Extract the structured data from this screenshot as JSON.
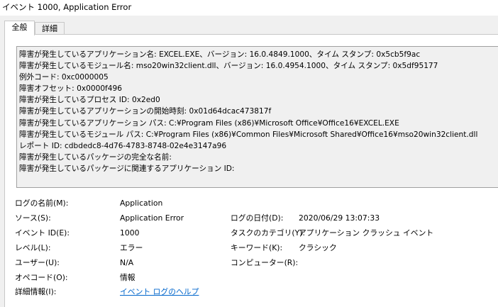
{
  "window": {
    "title": "イベント 1000, Application Error"
  },
  "tabs": [
    {
      "label": "全般",
      "active": true
    },
    {
      "label": "詳細",
      "active": false
    }
  ],
  "description": {
    "lines": [
      "障害が発生しているアプリケーション名: EXCEL.EXE、バージョン: 16.0.4849.1000、タイム スタンプ: 0x5cb5f9ac",
      "障害が発生しているモジュール名: mso20win32client.dll、バージョン: 16.0.4954.1000、タイム スタンプ: 0x5df95177",
      "例外コード: 0xc0000005",
      "障害オフセット: 0x0000f496",
      "障害が発生しているプロセス ID: 0x2ed0",
      "障害が発生しているアプリケーションの開始時刻: 0x01d64dcac473817f",
      "障害が発生しているアプリケーション パス: C:¥Program Files (x86)¥Microsoft Office¥Office16¥EXCEL.EXE",
      "障害が発生しているモジュール パス: C:¥Program Files (x86)¥Common Files¥Microsoft Shared¥Office16¥mso20win32client.dll",
      "レポート ID: cdbdedc8-4d76-4783-8748-02e4e3147a96",
      "障害が発生しているパッケージの完全な名前:",
      "障害が発生しているパッケージに関連するアプリケーション ID:"
    ]
  },
  "details": {
    "log_name_label": "ログの名前(M):",
    "log_name_value": "Application",
    "source_label": "ソース(S):",
    "source_value": "Application Error",
    "logged_label": "ログの日付(D):",
    "logged_value": "2020/06/29 13:07:33",
    "event_id_label": "イベント ID(E):",
    "event_id_value": "1000",
    "task_category_label": "タスクのカテゴリ(Y):",
    "task_category_value": "アプリケーション クラッシュ イベント",
    "level_label": "レベル(L):",
    "level_value": "エラー",
    "keywords_label": "キーワード(K):",
    "keywords_value": "クラシック",
    "user_label": "ユーザー(U):",
    "user_value": "N/A",
    "computer_label": "コンピューター(R):",
    "computer_value": "",
    "opcode_label": "オペコード(O):",
    "opcode_value": "情報",
    "more_info_label": "詳細情報(I):",
    "more_info_link": "イベント ログのヘルプ"
  }
}
